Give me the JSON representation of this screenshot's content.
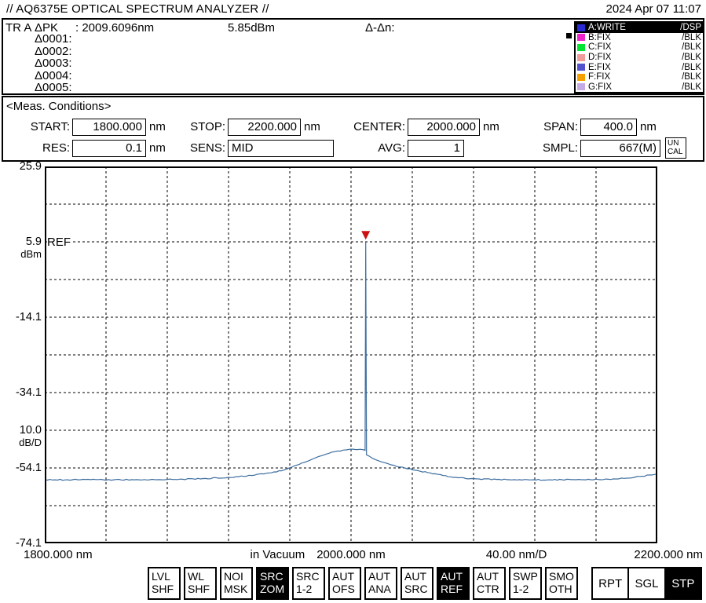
{
  "header": {
    "title": "// AQ6375E OPTICAL SPECTRUM ANALYZER //",
    "datetime": "2024 Apr 07 11:07"
  },
  "marker_panel": {
    "trace": "TR A",
    "peak": {
      "label": "ΔPK",
      "value": ": 2009.6096nm",
      "level": "5.85dBm",
      "delta_header": "Δ-Δn:"
    },
    "delta_rows": [
      "Δ0001:",
      "Δ0002:",
      "Δ0003:",
      "Δ0004:",
      "Δ0005:"
    ]
  },
  "trace_legend": {
    "items": [
      {
        "name": "A:WRITE",
        "mode": "/DSP",
        "color": "#2a2ad4",
        "active": true
      },
      {
        "name": "B:FIX",
        "mode": "/BLK",
        "color": "#ee22cc",
        "active": false
      },
      {
        "name": "C:FIX",
        "mode": "/BLK",
        "color": "#00e432",
        "active": false
      },
      {
        "name": "D:FIX",
        "mode": "/BLK",
        "color": "#f29b9b",
        "active": false
      },
      {
        "name": "E:FIX",
        "mode": "/BLK",
        "color": "#5252cc",
        "active": false
      },
      {
        "name": "F:FIX",
        "mode": "/BLK",
        "color": "#f5a000",
        "active": false
      },
      {
        "name": "G:FIX",
        "mode": "/BLK",
        "color": "#c6aae6",
        "active": false
      }
    ]
  },
  "meas_conditions": {
    "heading": "<Meas. Conditions>",
    "fields": [
      {
        "label": "START:",
        "value": "1800.000",
        "unit": "nm"
      },
      {
        "label": "STOP:",
        "value": "2200.000",
        "unit": "nm"
      },
      {
        "label": "CENTER:",
        "value": "2000.000",
        "unit": "nm"
      },
      {
        "label": "SPAN:",
        "value": "400.0",
        "unit": "nm"
      },
      {
        "label": "RES:",
        "value": "0.1",
        "unit": "nm"
      },
      {
        "label": "SENS:",
        "value": "MID",
        "unit": ""
      },
      {
        "label": "AVG:",
        "value": "1",
        "unit": ""
      },
      {
        "label": "SMPL:",
        "value": "667(M)",
        "unit": ""
      }
    ],
    "uncal": {
      "line1": "UN",
      "line2": "CAL"
    }
  },
  "chart_data": {
    "type": "line",
    "title": "Optical spectrum, trace A",
    "x_unit": "nm",
    "y_unit": "dBm",
    "x_range": [
      1800,
      2200
    ],
    "y_range": [
      -74.1,
      25.9
    ],
    "x_divisions": 10,
    "y_divisions": 10,
    "ref_level_dbm": 5.9,
    "scale_per_div": "10.0 dB/D",
    "span_per_div": "40.00 nm/D",
    "grid": true,
    "ref_label": "REF",
    "y_axis_labels": [
      {
        "text": "25.9",
        "div": 0,
        "sub": ""
      },
      {
        "text": "5.9",
        "div": 2,
        "sub": "dBm"
      },
      {
        "text": "-14.1",
        "div": 4,
        "sub": ""
      },
      {
        "text": "-34.1",
        "div": 6,
        "sub": ""
      },
      {
        "text": "10.0",
        "div": 7,
        "sub": "dB/D"
      },
      {
        "text": "-54.1",
        "div": 8,
        "sub": ""
      },
      {
        "text": "-74.1",
        "div": 10,
        "sub": ""
      }
    ],
    "x_axis_labels": [
      {
        "text": "1800.000 nm",
        "anchor": "left",
        "frac": 0
      },
      {
        "text": "in Vacuum",
        "anchor": "center",
        "frac": 0.38
      },
      {
        "text": "2000.000 nm",
        "anchor": "center",
        "frac": 0.5
      },
      {
        "text": "40.00 nm/D",
        "anchor": "center",
        "frac": 0.77
      },
      {
        "text": "2200.000 nm",
        "anchor": "right",
        "frac": 1
      }
    ],
    "series": [
      {
        "name": "Trace A",
        "color": "#3f6fa0",
        "points": [
          [
            1800,
            -57.2
          ],
          [
            1815,
            -57.25
          ],
          [
            1830,
            -57.2
          ],
          [
            1845,
            -57.25
          ],
          [
            1860,
            -57.2
          ],
          [
            1875,
            -57.2
          ],
          [
            1890,
            -57.1
          ],
          [
            1905,
            -56.9
          ],
          [
            1920,
            -56.6
          ],
          [
            1935,
            -56.1
          ],
          [
            1948,
            -55.4
          ],
          [
            1958,
            -54.4
          ],
          [
            1966,
            -53.2
          ],
          [
            1974,
            -51.9
          ],
          [
            1982,
            -50.7
          ],
          [
            1989,
            -49.8
          ],
          [
            1995,
            -49.35
          ],
          [
            2001,
            -49.1
          ],
          [
            2006,
            -49.15
          ],
          [
            2008.6,
            -49.3
          ],
          [
            2009.2,
            -49.45
          ],
          [
            2009.6,
            5.85
          ],
          [
            2010.1,
            -50.6
          ],
          [
            2012,
            -51.0
          ],
          [
            2016,
            -51.9
          ],
          [
            2022,
            -52.7
          ],
          [
            2028,
            -53.4
          ],
          [
            2035,
            -54.1
          ],
          [
            2042,
            -54.7
          ],
          [
            2050,
            -55.3
          ],
          [
            2060,
            -56.1
          ],
          [
            2070,
            -56.7
          ],
          [
            2082,
            -57.0
          ],
          [
            2095,
            -57.15
          ],
          [
            2110,
            -57.2
          ],
          [
            2130,
            -57.25
          ],
          [
            2150,
            -57.2
          ],
          [
            2168,
            -57.1
          ],
          [
            2180,
            -56.8
          ],
          [
            2190,
            -56.3
          ],
          [
            2200,
            -55.7
          ]
        ]
      }
    ],
    "peak_marker": {
      "wavelength_nm": 2009.6,
      "level_dbm": 5.85,
      "color": "#cc1111",
      "shape": "triangle-down"
    }
  },
  "softkeys": {
    "left": [
      {
        "line1": "LVL",
        "line2": "SHF",
        "active": false
      },
      {
        "line1": "WL",
        "line2": "SHF",
        "active": false
      },
      {
        "line1": "NOI",
        "line2": "MSK",
        "active": false
      },
      {
        "line1": "SRC",
        "line2": "ZOM",
        "active": true
      },
      {
        "line1": "SRC",
        "line2": "1-2",
        "active": false
      },
      {
        "line1": "AUT",
        "line2": "OFS",
        "active": false
      },
      {
        "line1": "AUT",
        "line2": "ANA",
        "active": false
      },
      {
        "line1": "AUT",
        "line2": "SRC",
        "active": false
      },
      {
        "line1": "AUT",
        "line2": "REF",
        "active": true
      },
      {
        "line1": "AUT",
        "line2": "CTR",
        "active": false
      },
      {
        "line1": "SWP",
        "line2": "1-2",
        "active": false
      },
      {
        "line1": "SMO",
        "line2": "OTH",
        "active": false
      }
    ],
    "right": [
      {
        "label": "RPT",
        "active": false
      },
      {
        "label": "SGL",
        "active": false
      },
      {
        "label": "STP",
        "active": true
      }
    ]
  }
}
